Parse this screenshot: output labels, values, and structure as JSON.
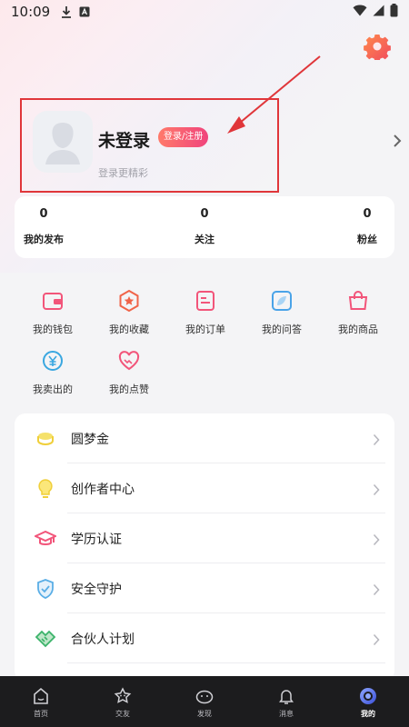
{
  "status_bar": {
    "time": "10:09"
  },
  "profile": {
    "title": "未登录",
    "login_button": "登录/注册",
    "subtitle": "登录更精彩"
  },
  "stats": [
    {
      "value": "0",
      "label": "我的发布"
    },
    {
      "value": "0",
      "label": "关注"
    },
    {
      "value": "0",
      "label": "粉丝"
    }
  ],
  "grid": [
    {
      "label": "我的钱包",
      "icon": "wallet-icon"
    },
    {
      "label": "我的收藏",
      "icon": "star-icon"
    },
    {
      "label": "我的订单",
      "icon": "order-icon"
    },
    {
      "label": "我的问答",
      "icon": "qa-icon"
    },
    {
      "label": "我的商品",
      "icon": "bag-icon"
    },
    {
      "label": "我卖出的",
      "icon": "yuan-icon"
    },
    {
      "label": "我的点赞",
      "icon": "heart-icon"
    }
  ],
  "menu": [
    {
      "label": "圆梦金",
      "icon": "coin-icon"
    },
    {
      "label": "创作者中心",
      "icon": "bulb-icon"
    },
    {
      "label": "学历认证",
      "icon": "graduation-cap-icon"
    },
    {
      "label": "安全守护",
      "icon": "shield-icon"
    },
    {
      "label": "合伙人计划",
      "icon": "handshake-icon"
    }
  ],
  "tabs": [
    {
      "label": "首页",
      "icon": "home-icon"
    },
    {
      "label": "交友",
      "icon": "friends-icon"
    },
    {
      "label": "发现",
      "icon": "discover-icon"
    },
    {
      "label": "消息",
      "icon": "bell-icon"
    },
    {
      "label": "我的",
      "icon": "profile-icon",
      "active": true
    }
  ],
  "colors": {
    "accent_red": "#e0363a",
    "login_gradient_start": "#ff7a6a",
    "login_gradient_end": "#f0447d",
    "tab_bar_bg": "#1c1c1e"
  }
}
